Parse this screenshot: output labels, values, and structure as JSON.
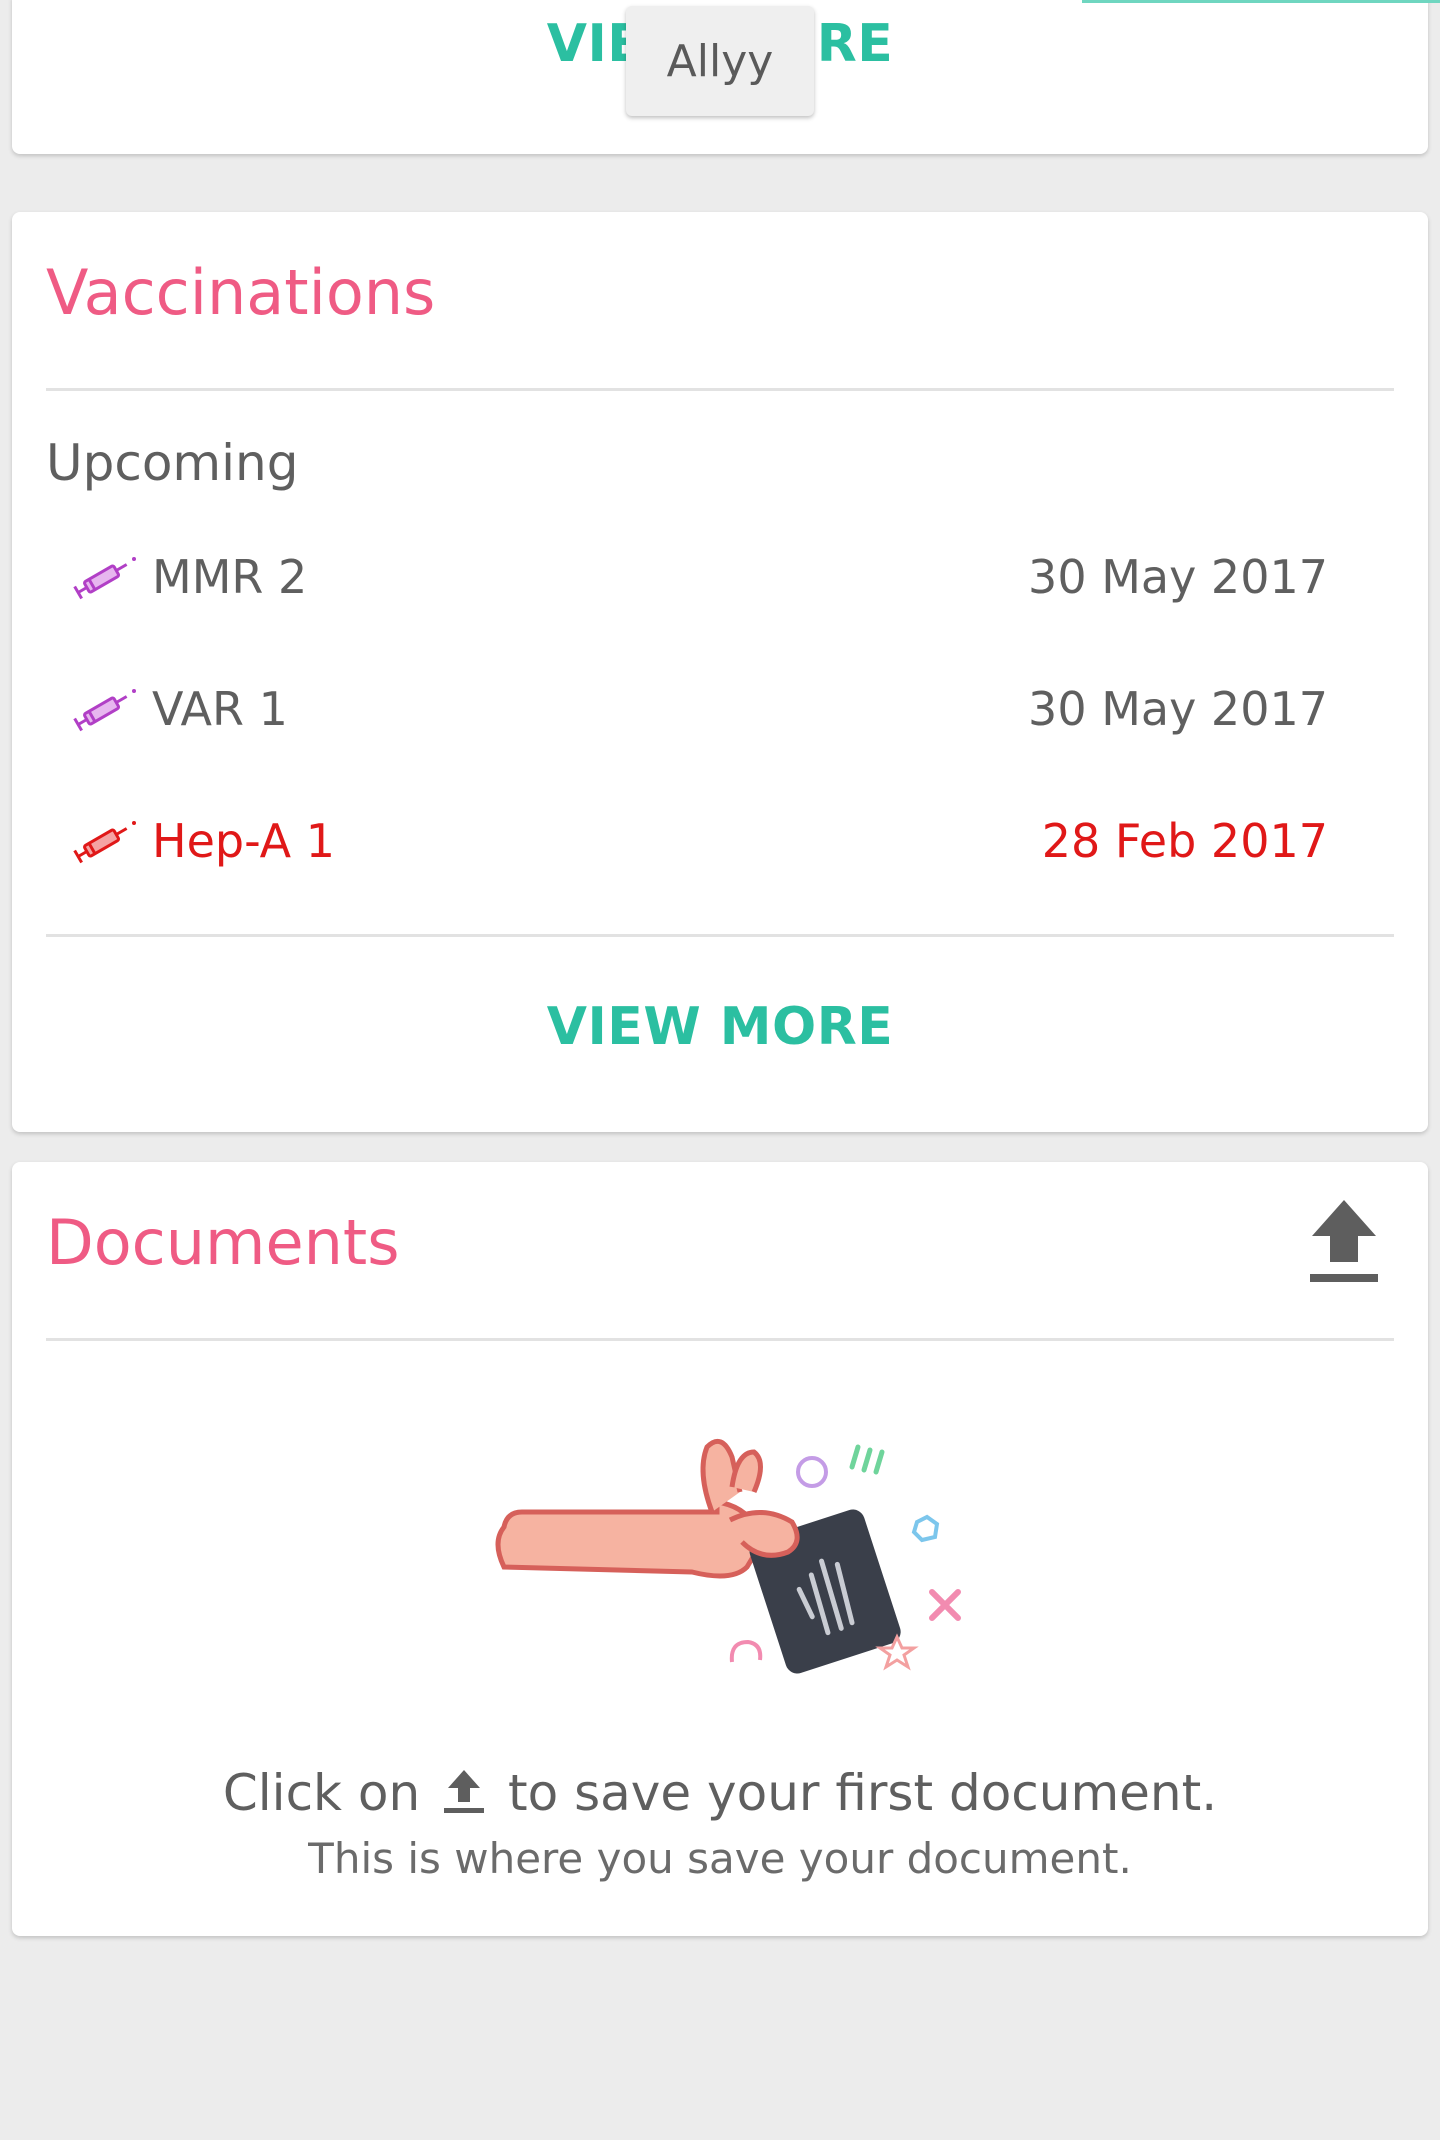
{
  "top_card": {
    "view_more_label": "VIEW MORE",
    "tooltip_text": "Allyy"
  },
  "vaccinations": {
    "title": "Vaccinations",
    "subtitle": "Upcoming",
    "items": [
      {
        "name": "MMR 2",
        "date": "30 May 2017",
        "status": "upcoming",
        "icon": "syringe-icon",
        "color": "#b13fc6"
      },
      {
        "name": "VAR 1",
        "date": "30 May 2017",
        "status": "upcoming",
        "icon": "syringe-icon",
        "color": "#b13fc6"
      },
      {
        "name": "Hep-A 1",
        "date": "28 Feb 2017",
        "status": "overdue",
        "icon": "syringe-icon",
        "color": "#e01818"
      }
    ],
    "view_more_label": "VIEW MORE"
  },
  "documents": {
    "title": "Documents",
    "upload_icon": "upload-icon",
    "empty_message_prefix": "Click on",
    "empty_message_suffix": "to save your first document.",
    "empty_subtext": "This is where you save your document."
  },
  "colors": {
    "accent_teal": "#2bbfa1",
    "title_pink": "#ef5b84",
    "overdue_red": "#e01818",
    "background": "#ececec"
  }
}
